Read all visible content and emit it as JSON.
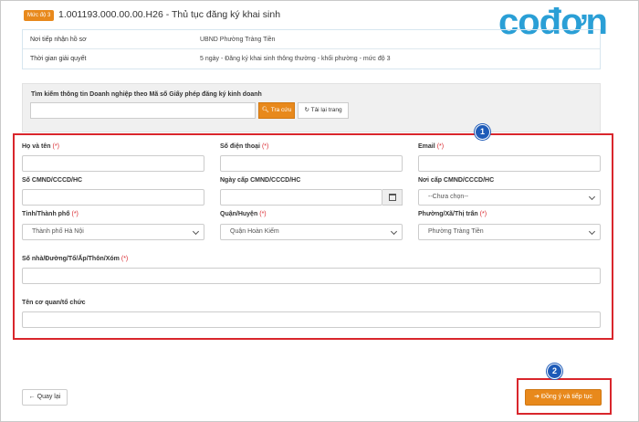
{
  "header": {
    "level_badge": "Mức độ 3",
    "title": "1.001193.000.00.00.H26 - Thủ tục đăng ký khai sinh"
  },
  "logo": {
    "text": "cođơn"
  },
  "info": [
    {
      "label": "Nơi tiếp nhận hồ sơ",
      "value": "UBND Phường Tràng Tiền"
    },
    {
      "label": "Thời gian giải quyết",
      "value": "5 ngày - Đăng ký khai sinh thông thường - khối phường - mức độ 3"
    }
  ],
  "search": {
    "label": "Tìm kiếm thông tin Doanh nghiệp theo Mã số Giấy phép đăng ký kinh doanh",
    "input_value": "",
    "search_button": "Tra cứu",
    "reload_button": "Tải lại trang"
  },
  "form": {
    "badge": "1",
    "required_mark": "(*)",
    "fields": {
      "ho_ten": {
        "label": "Họ và tên",
        "value": ""
      },
      "so_dien_thoai": {
        "label": "Số điện thoại",
        "value": ""
      },
      "email": {
        "label": "Email",
        "value": ""
      },
      "so_cmnd": {
        "label": "Số CMND/CCCD/HC",
        "value": ""
      },
      "ngay_cap": {
        "label": "Ngày cấp CMND/CCCD/HC",
        "value": ""
      },
      "noi_cap": {
        "label": "Nơi cấp CMND/CCCD/HC",
        "value": "--Chưa chọn--"
      },
      "tinh": {
        "label": "Tỉnh/Thành phố",
        "value": "Thành phố Hà Nội"
      },
      "quan": {
        "label": "Quận/Huyện",
        "value": "Quận Hoàn Kiếm"
      },
      "phuong": {
        "label": "Phường/Xã/Thị trấn",
        "value": "Phường Tràng Tiền"
      },
      "dia_chi": {
        "label": "Số nhà/Đường/Tổ/Ấp/Thôn/Xóm",
        "value": ""
      },
      "co_quan": {
        "label": "Tên cơ quan/tổ chức",
        "value": ""
      }
    }
  },
  "footer": {
    "back_button": "Quay lại",
    "continue_badge": "2",
    "continue_button": "Đồng ý và tiếp tục"
  },
  "colors": {
    "accent": "#e8891c",
    "highlight": "#d9262c",
    "badge": "#1e5bb8",
    "logo": "#2a9fd6"
  }
}
